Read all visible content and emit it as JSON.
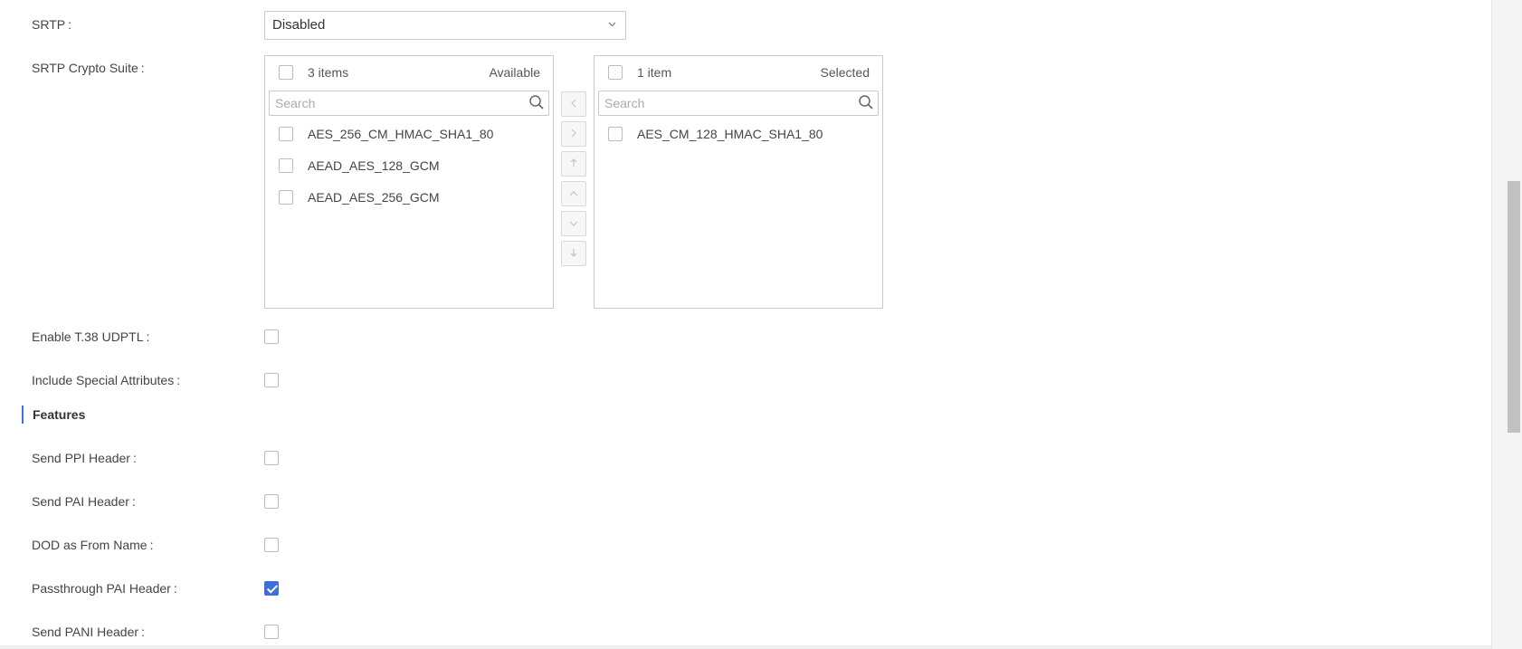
{
  "srtp": {
    "label": "SRTP",
    "value": "Disabled"
  },
  "crypto_suite": {
    "label": "SRTP Crypto Suite",
    "available": {
      "count": "3 items",
      "title": "Available",
      "search_placeholder": "Search",
      "items": [
        {
          "label": "AES_256_CM_HMAC_SHA1_80",
          "checked": false
        },
        {
          "label": "AEAD_AES_128_GCM",
          "checked": false
        },
        {
          "label": "AEAD_AES_256_GCM",
          "checked": false
        }
      ]
    },
    "selected": {
      "count": "1 item",
      "title": "Selected",
      "search_placeholder": "Search",
      "items": [
        {
          "label": "AES_CM_128_HMAC_SHA1_80",
          "checked": false
        }
      ]
    },
    "operations": [
      "move-left",
      "move-right",
      "move-top",
      "move-up",
      "move-down",
      "move-bottom"
    ]
  },
  "options": {
    "enable_t38": {
      "label": "Enable T.38 UDPTL",
      "checked": false
    },
    "include_special": {
      "label": "Include Special Attributes",
      "checked": false
    }
  },
  "features": {
    "title": "Features",
    "send_ppi": {
      "label": "Send PPI Header",
      "checked": false
    },
    "send_pai": {
      "label": "Send PAI Header",
      "checked": false
    },
    "dod_from_name": {
      "label": "DOD as From Name",
      "checked": false
    },
    "passthrough_pai": {
      "label": "Passthrough PAI Header",
      "checked": true
    },
    "send_pani": {
      "label": "Send PANI Header",
      "checked": false
    }
  },
  "colon": ":",
  "colors": {
    "accent": "#3f6fd8",
    "border": "#c9c9c9",
    "text": "#444444"
  }
}
